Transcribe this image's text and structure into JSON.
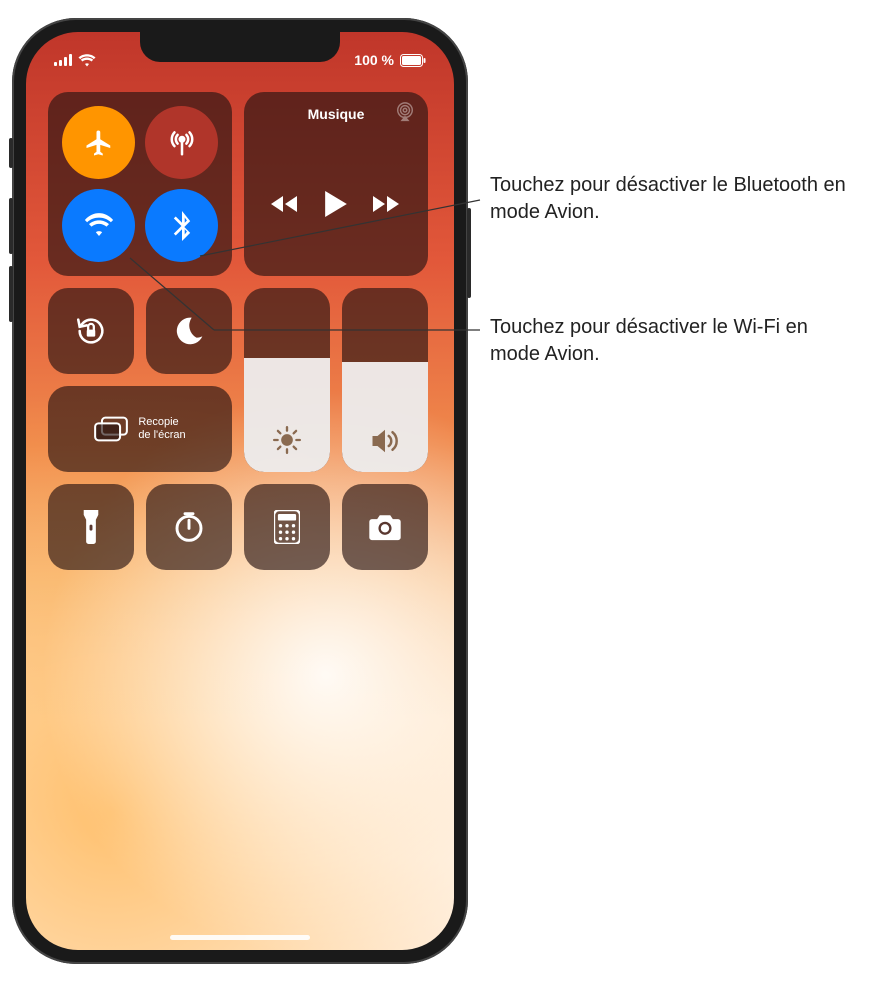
{
  "status": {
    "battery_text": "100 %"
  },
  "media": {
    "title": "Musique"
  },
  "screen_mirror": {
    "label": "Recopie\nde l'écran"
  },
  "brightness": {
    "level_percent": 62
  },
  "volume": {
    "level_percent": 60
  },
  "callouts": {
    "bluetooth": "Touchez pour désactiver le Bluetooth en mode Avion.",
    "wifi": "Touchez pour désactiver le Wi‑Fi en mode Avion."
  },
  "icons": {
    "airplane": "airplane-icon",
    "cellular": "antenna-icon",
    "wifi": "wifi-icon",
    "bluetooth": "bluetooth-icon",
    "airplay": "airplay-icon",
    "prev": "prev-track-icon",
    "play": "play-icon",
    "next": "next-track-icon",
    "lock_rotation": "rotation-lock-icon",
    "dnd": "do-not-disturb-icon",
    "screen_mirror": "screen-mirror-icon",
    "brightness": "brightness-icon",
    "volume": "volume-icon",
    "flashlight": "flashlight-icon",
    "timer": "timer-icon",
    "calculator": "calculator-icon",
    "camera": "camera-icon"
  }
}
